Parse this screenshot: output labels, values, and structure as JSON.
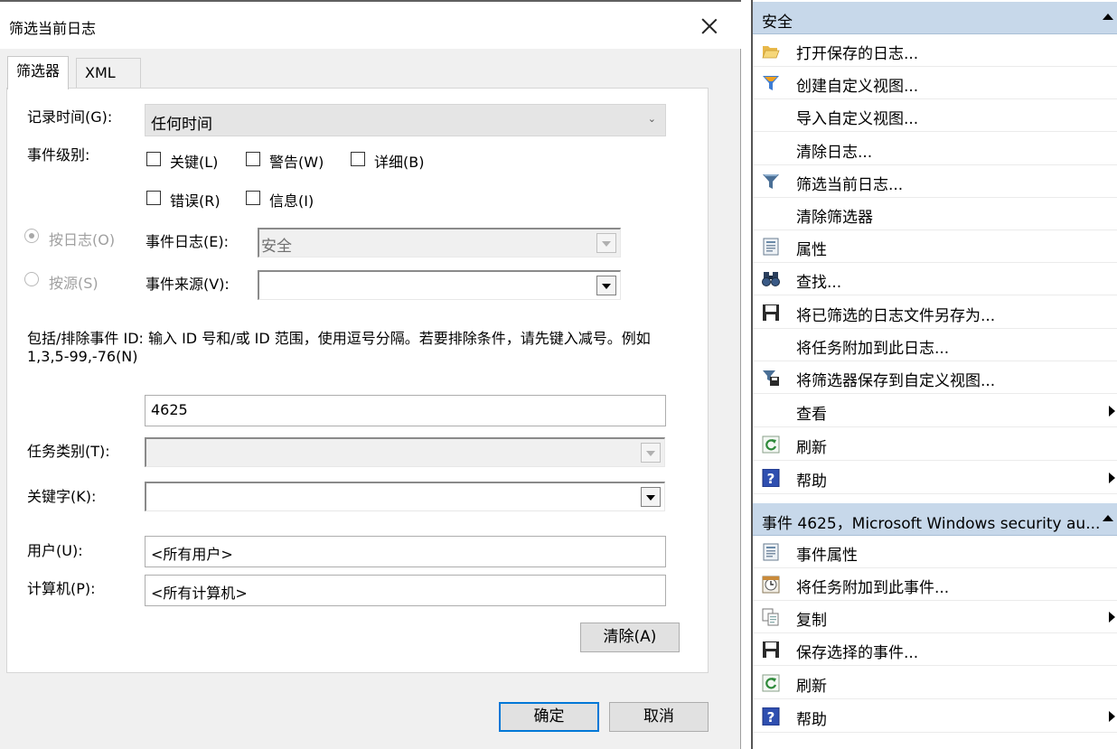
{
  "dialog": {
    "title": "筛选当前日志",
    "tabs": [
      "筛选器",
      "XML"
    ],
    "logged_label": "记录时间(G):",
    "logged_value": "任何时间",
    "level_label": "事件级别:",
    "levels": [
      "关键(L)",
      "警告(W)",
      "详细(B)",
      "错误(R)",
      "信息(I)"
    ],
    "by_log_label": "按日志(O)",
    "by_source_label": "按源(S)",
    "event_logs_label": "事件日志(E):",
    "event_logs_value": "安全",
    "event_sources_label": "事件来源(V):",
    "description": "包括/排除事件 ID: 输入 ID 号和/或 ID 范围，使用逗号分隔。若要排除条件，请先键入减号。例如 1,3,5-99,-76(N)",
    "event_id_value": "4625",
    "task_category_label": "任务类别(T):",
    "keywords_label": "关键字(K):",
    "user_label": "用户(U):",
    "user_value": "<所有用户>",
    "computer_label": "计算机(P):",
    "computer_value": "<所有计算机>",
    "clear_button": "清除(A)",
    "ok_button": "确定",
    "cancel_button": "取消"
  },
  "actions": {
    "section1_title": "安全",
    "section1_items": [
      {
        "label": "打开保存的日志...",
        "icon": "folder-open-icon"
      },
      {
        "label": "创建自定义视图...",
        "icon": "funnel-color-icon"
      },
      {
        "label": "导入自定义视图...",
        "icon": ""
      },
      {
        "label": "清除日志...",
        "icon": ""
      },
      {
        "label": "筛选当前日志...",
        "icon": "filter-icon"
      },
      {
        "label": "清除筛选器",
        "icon": ""
      },
      {
        "label": "属性",
        "icon": "properties-icon"
      },
      {
        "label": "查找...",
        "icon": "binoculars-icon"
      },
      {
        "label": "将已筛选的日志文件另存为...",
        "icon": "save-icon"
      },
      {
        "label": "将任务附加到此日志...",
        "icon": ""
      },
      {
        "label": "将筛选器保存到自定义视图...",
        "icon": "filter-save-icon"
      },
      {
        "label": "查看",
        "icon": ""
      },
      {
        "label": "刷新",
        "icon": "refresh-icon"
      },
      {
        "label": "帮助",
        "icon": "help-icon"
      }
    ],
    "section2_title": "事件 4625，Microsoft Windows security au...",
    "section2_items": [
      {
        "label": "事件属性",
        "icon": "properties-icon"
      },
      {
        "label": "将任务附加到此事件...",
        "icon": "task-clock-icon"
      },
      {
        "label": "复制",
        "icon": "copy-icon"
      },
      {
        "label": "保存选择的事件...",
        "icon": "save-icon"
      },
      {
        "label": "刷新",
        "icon": "refresh-icon"
      },
      {
        "label": "帮助",
        "icon": "help-icon"
      }
    ]
  }
}
